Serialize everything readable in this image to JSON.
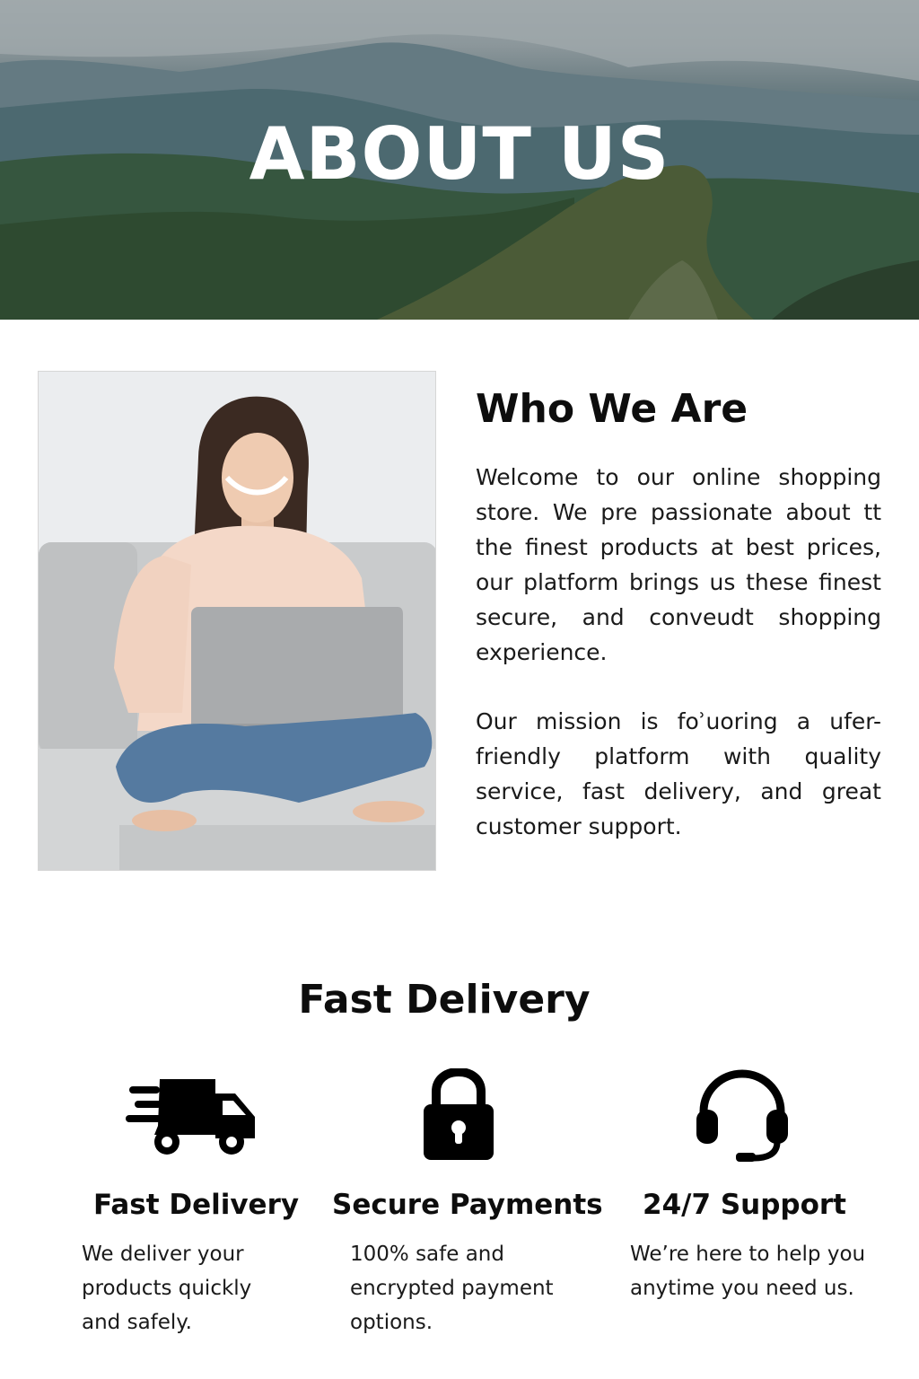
{
  "hero": {
    "title": "ABOUT US"
  },
  "who": {
    "title": "Who We Are",
    "paragraphs": [
      "Welcome to our online shopping store. We pre passionate about tt the finest products at best prices, our platform brings us these finest secure, and conveudt shopping experience.",
      "Our mission is foʾuoring a ufer-friendly platform with quality service, fast delivery, and great customer support."
    ]
  },
  "features": {
    "section_title": "Fast Delivery",
    "items": [
      {
        "icon": "truck-icon",
        "title": "Fast Delivery",
        "description": "We deliver your products quickly and safely."
      },
      {
        "icon": "lock-icon",
        "title": "Secure Payments",
        "description": "100% safe and encrypted payment options."
      },
      {
        "icon": "headset-icon",
        "title": "24/7 Support",
        "description": "We’re here to help you anytime you need us."
      }
    ]
  }
}
